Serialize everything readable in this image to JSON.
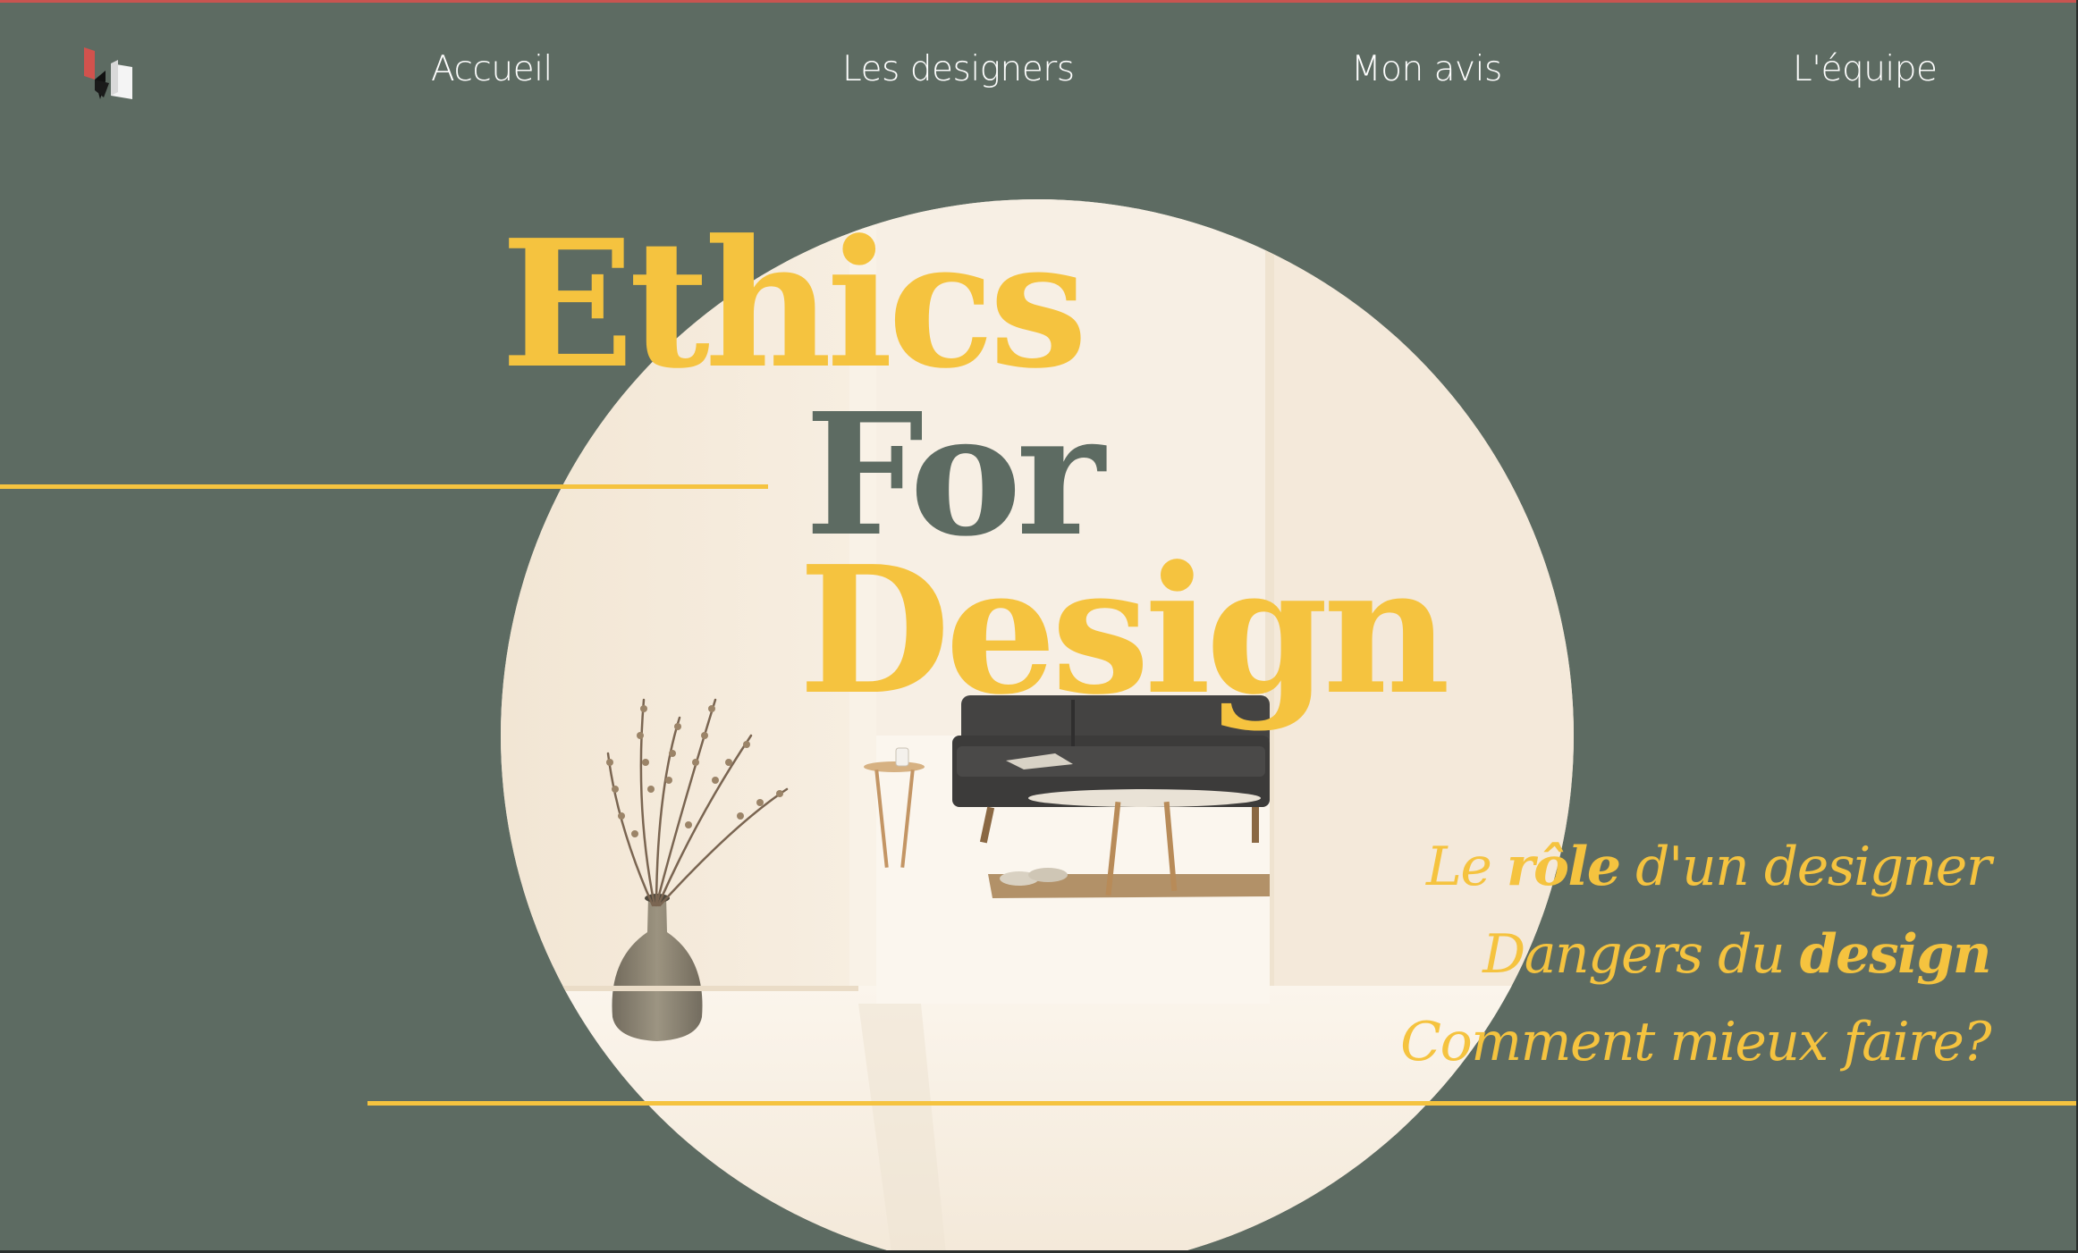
{
  "nav": {
    "logo_label": "logo",
    "items": [
      {
        "label": "Accueil"
      },
      {
        "label": "Les designers"
      },
      {
        "label": "Mon avis"
      },
      {
        "label": "L'équipe"
      }
    ]
  },
  "hero": {
    "title": {
      "word1": "Ethics",
      "word2": "For",
      "word3": "Design"
    },
    "image": "living-room-illustration"
  },
  "sections": [
    {
      "before": "Le ",
      "bold": "rôle",
      "after": " d'un designer"
    },
    {
      "before": "Dangers du ",
      "bold": "design",
      "after": ""
    },
    {
      "before": "Comment mieux faire?",
      "bold": "",
      "after": ""
    }
  ],
  "colors": {
    "background": "#5d6b62",
    "accent": "#f5c33f",
    "circle": "#f5ebdb",
    "top_border": "#c85450"
  }
}
